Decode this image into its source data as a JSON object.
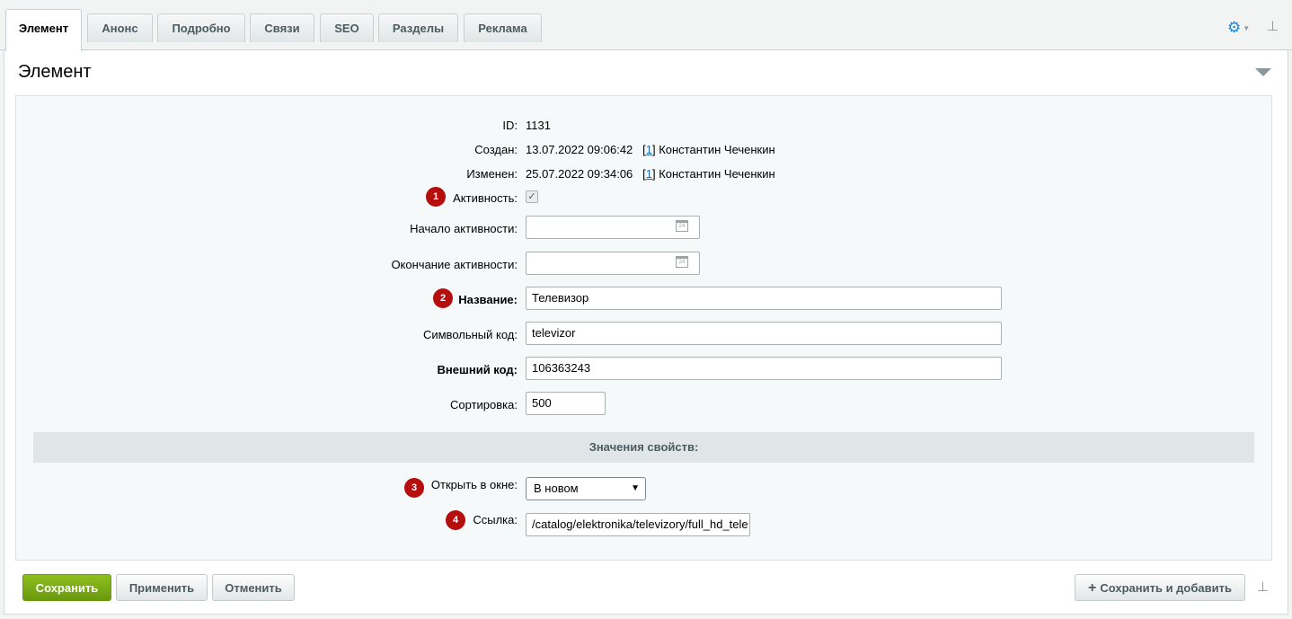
{
  "tabs": [
    "Элемент",
    "Анонс",
    "Подробно",
    "Связи",
    "SEO",
    "Разделы",
    "Реклама"
  ],
  "section_title": "Элемент",
  "fields": {
    "id_label": "ID:",
    "id_value": "1131",
    "created_label": "Создан:",
    "created_date": "13.07.2022 09:06:42",
    "created_user_link": "1",
    "created_user_name": "Константин Чеченкин",
    "modified_label": "Изменен:",
    "modified_date": "25.07.2022 09:34:06",
    "modified_user_link": "1",
    "modified_user_name": "Константин Чеченкин",
    "active_label": "Активность:",
    "active_checked": true,
    "active_from_label": "Начало активности:",
    "active_from_value": "",
    "active_to_label": "Окончание активности:",
    "active_to_value": "",
    "name_label": "Название:",
    "name_value": "Телевизор",
    "code_label": "Символьный код:",
    "code_value": "televizor",
    "xml_id_label": "Внешний код:",
    "xml_id_value": "106363243",
    "sort_label": "Сортировка:",
    "sort_value": "500"
  },
  "properties": {
    "header": "Значения свойств:",
    "open_in_label": "Открыть в окне:",
    "open_in_value": "В новом",
    "link_label": "Ссылка:",
    "link_value": "/catalog/elektronika/televizory/full_hd_tele"
  },
  "badges": [
    "1",
    "2",
    "3",
    "4"
  ],
  "calendar_icon_text": "24",
  "buttons": {
    "save": "Сохранить",
    "apply": "Применить",
    "cancel": "Отменить",
    "save_add": "Сохранить и добавить"
  },
  "colors": {
    "accent_blue": "#1b87d6",
    "save_green": "#7aab17",
    "badge_red": "#b60d0d",
    "link_blue": "#2067b0"
  },
  "icons": {
    "settings": "gear-icon",
    "pin": "pin-icon",
    "collapse": "triangle-down-icon",
    "calendar": "calendar-icon",
    "plus": "plus-icon"
  }
}
